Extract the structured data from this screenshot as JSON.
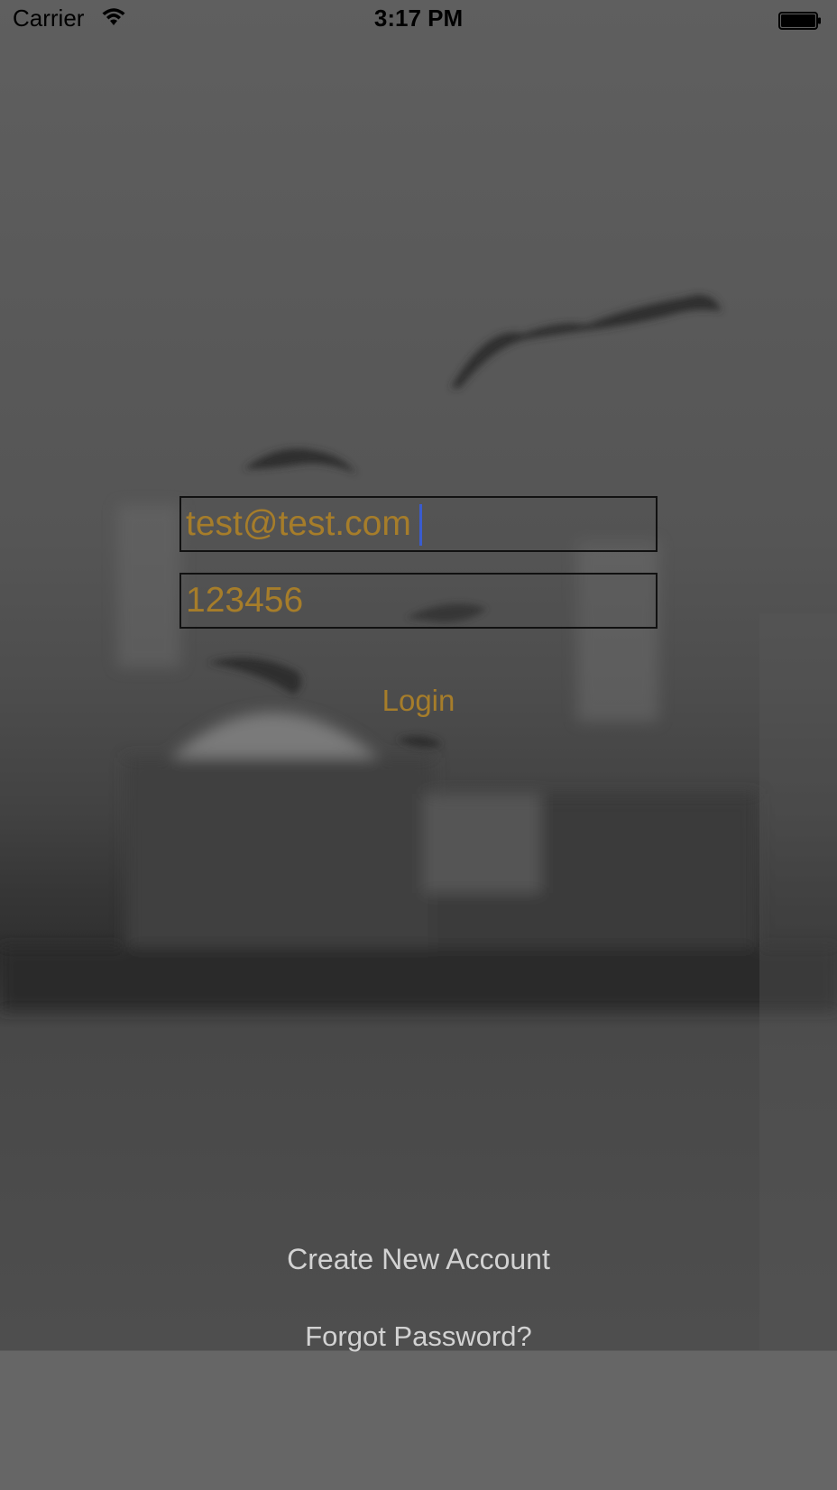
{
  "status_bar": {
    "carrier": "Carrier",
    "time": "3:17 PM",
    "wifi_icon": "wifi-icon",
    "battery_icon": "battery-full-icon"
  },
  "login_form": {
    "email_value": "test@test.com",
    "password_value": "123456",
    "login_label": "Login"
  },
  "links": {
    "create_account_label": "Create New Account",
    "forgot_password_label": "Forgot Password?"
  },
  "colors": {
    "accent": "#a67d2a",
    "caret": "#3a5ccf",
    "link_text": "#d2d2d2",
    "status_text": "#000000"
  }
}
